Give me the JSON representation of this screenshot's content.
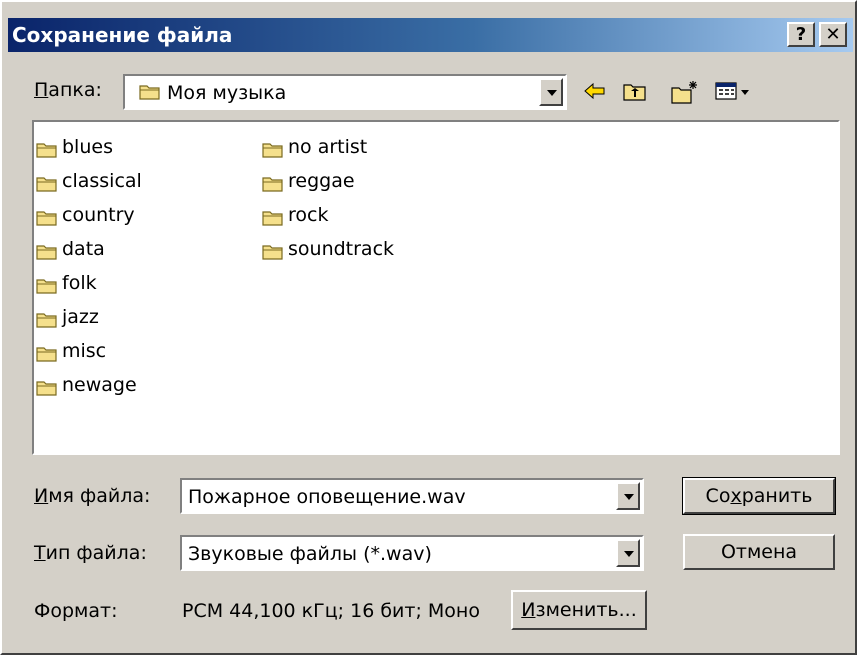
{
  "window": {
    "title": "Сохранение файла",
    "help_label": "?",
    "close_label": "✕"
  },
  "folder": {
    "label_prefix": "П",
    "label_rest": "апка:",
    "value": "Моя музыка"
  },
  "toolbar_icons": [
    "back-arrow-icon",
    "up-folder-icon",
    "new-folder-icon",
    "view-menu-icon"
  ],
  "files": {
    "col1": [
      "blues",
      "classical",
      "country",
      "data",
      "folk",
      "jazz",
      "misc",
      "newage"
    ],
    "col2": [
      "no artist",
      "reggae",
      "rock",
      "soundtrack"
    ]
  },
  "filename": {
    "label_prefix": "И",
    "label_rest": "мя файла:",
    "value": "Пожарное оповещение.wav"
  },
  "filetype": {
    "label_prefix": "Т",
    "label_rest": "ип файла:",
    "value": "Звуковые файлы (*.wav)"
  },
  "format": {
    "label": "Формат:",
    "value": "PCM 44,100 кГц; 16 бит; Моно"
  },
  "buttons": {
    "save_prefix": "Со",
    "save_u": "х",
    "save_rest": "ранить",
    "cancel": "Отмена",
    "change_u": "И",
    "change_rest": "зменить..."
  },
  "colors": {
    "title_start": "#0a246a",
    "title_end": "#a6caf0",
    "folder_fill": "#f5e08c",
    "face": "#d4d0c8"
  }
}
